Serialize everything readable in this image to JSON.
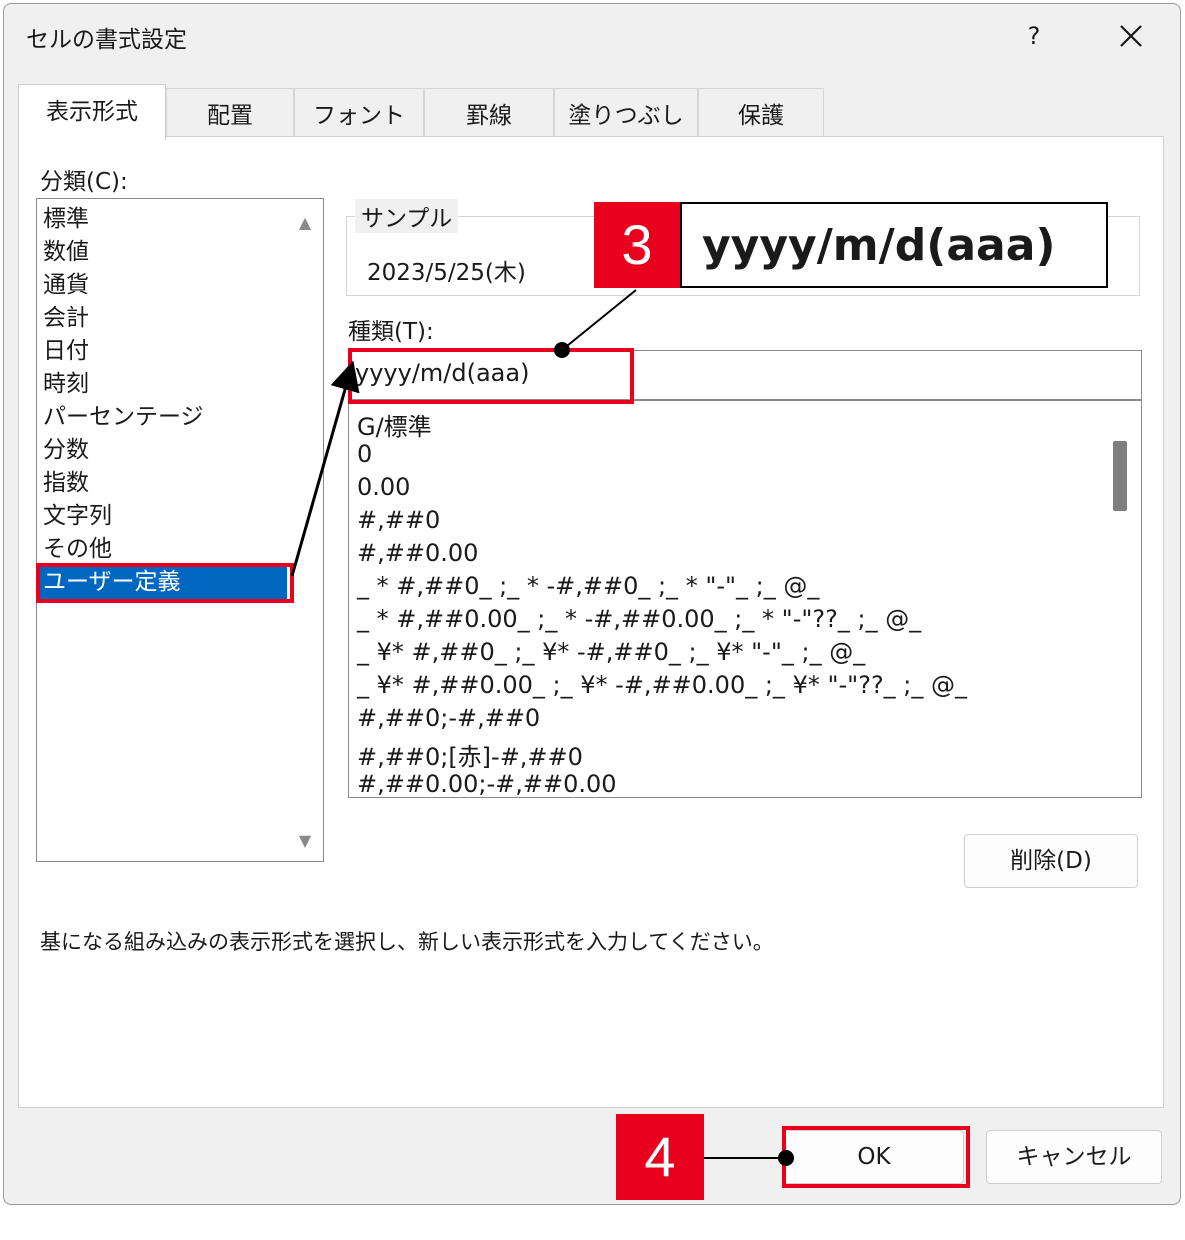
{
  "dialog": {
    "title": "セルの書式設定",
    "help": "?",
    "close_icon": "close-icon"
  },
  "tabs": [
    "表示形式",
    "配置",
    "フォント",
    "罫線",
    "塗りつぶし",
    "保護"
  ],
  "active_tab": "表示形式",
  "category": {
    "label": "分類(C):",
    "items": [
      "標準",
      "数値",
      "通貨",
      "会計",
      "日付",
      "時刻",
      "パーセンテージ",
      "分数",
      "指数",
      "文字列",
      "その他",
      "ユーザー定義"
    ],
    "selected": "ユーザー定義"
  },
  "sample": {
    "label": "サンプル",
    "value": "2023/5/25(木)"
  },
  "type": {
    "label": "種類(T):",
    "value": "yyyy/m/d(aaa)",
    "formats": [
      "G/標準",
      "0",
      "0.00",
      "#,##0",
      "#,##0.00",
      "_ * #,##0_ ;_ * -#,##0_ ;_ * \"-\"_ ;_ @_",
      "_ * #,##0.00_ ;_ * -#,##0.00_ ;_ * \"-\"??_ ;_ @_",
      "_ ¥* #,##0_ ;_ ¥* -#,##0_ ;_ ¥* \"-\"_ ;_ @_",
      "_ ¥* #,##0.00_ ;_ ¥* -#,##0.00_ ;_ ¥* \"-\"??_ ;_ @_",
      "#,##0;-#,##0",
      "#,##0;[赤]-#,##0",
      "#,##0.00;-#,##0.00"
    ]
  },
  "buttons": {
    "delete": "削除(D)",
    "ok": "OK",
    "cancel": "キャンセル"
  },
  "description": "基になる組み込みの表示形式を選択し、新しい表示形式を入力してください。",
  "annotations": {
    "step3_number": "3",
    "step3_text": "yyyy/m/d(aaa)",
    "step4_number": "4",
    "highlight_color": "#e8001c"
  },
  "colors": {
    "selection": "#0067c0",
    "dialog_bg": "#f0f0f0"
  }
}
